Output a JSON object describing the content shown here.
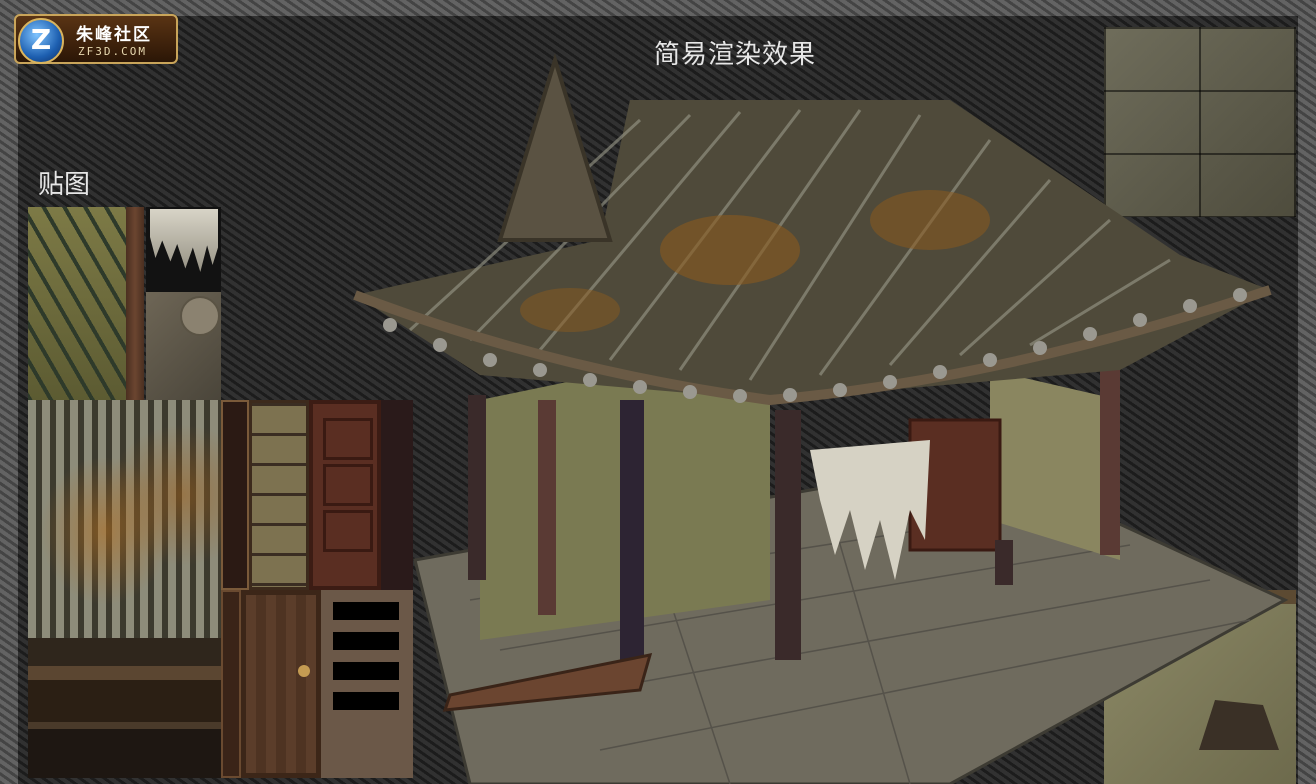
{
  "logo": {
    "badge_letter": "Z",
    "title": "朱峰社区",
    "subtitle": "ZF3D.COM"
  },
  "render": {
    "title": "简易渲染效果"
  },
  "textures": {
    "label": "贴图"
  },
  "colors": {
    "background": "#262626",
    "border": "#5b5b5b",
    "title_text": "#e6e6e6",
    "logo_gold": "#c9a55a"
  }
}
